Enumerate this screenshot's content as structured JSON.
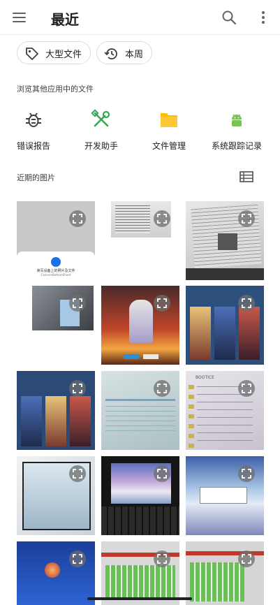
{
  "appbar": {
    "menu_icon": "hamburger-menu-icon",
    "title": "最近",
    "search_icon": "search-icon",
    "more_icon": "more-vertical-icon"
  },
  "chips": [
    {
      "label": "大型文件",
      "icon": "tag-icon"
    },
    {
      "label": "本周",
      "icon": "history-clock-icon"
    }
  ],
  "browse_section": {
    "title": "浏览其他应用中的文件",
    "apps": [
      {
        "label": "错误报告",
        "icon": "bug-icon"
      },
      {
        "label": "开发助手",
        "icon": "tools-icon"
      },
      {
        "label": "文件管理",
        "icon": "folder-icon"
      },
      {
        "label": "系统跟踪记录",
        "icon": "android-icon"
      }
    ]
  },
  "images_section": {
    "title": "近期的图片",
    "view_toggle_icon": "list-view-icon"
  },
  "thumbnails": [
    {
      "subject": "phone permission dialog",
      "dialog_text": "读写设备上的照片及文件",
      "dialog_sub": "ConsentBottomSheet"
    },
    {
      "subject": "printed document photo"
    },
    {
      "subject": "printed document photo"
    },
    {
      "subject": "monitor on desk photo"
    },
    {
      "subject": "game hero artwork"
    },
    {
      "subject": "game hero selection screen"
    },
    {
      "subject": "game hero selection screen"
    },
    {
      "subject": "pc bios screen"
    },
    {
      "subject": "bootice tool screen",
      "caption": "BOOTICE"
    },
    {
      "subject": "laptop screen"
    },
    {
      "subject": "laptop with keyboard"
    },
    {
      "subject": "desktop dialog"
    },
    {
      "subject": "pc screen with logo"
    },
    {
      "subject": "disk tool screen"
    },
    {
      "subject": "disk tool screen"
    }
  ],
  "colors": {
    "bug_icon": "#3c4043",
    "tools_icon": "#34a853",
    "folder_icon": "#fbbc04",
    "android_icon": "#78c257"
  }
}
